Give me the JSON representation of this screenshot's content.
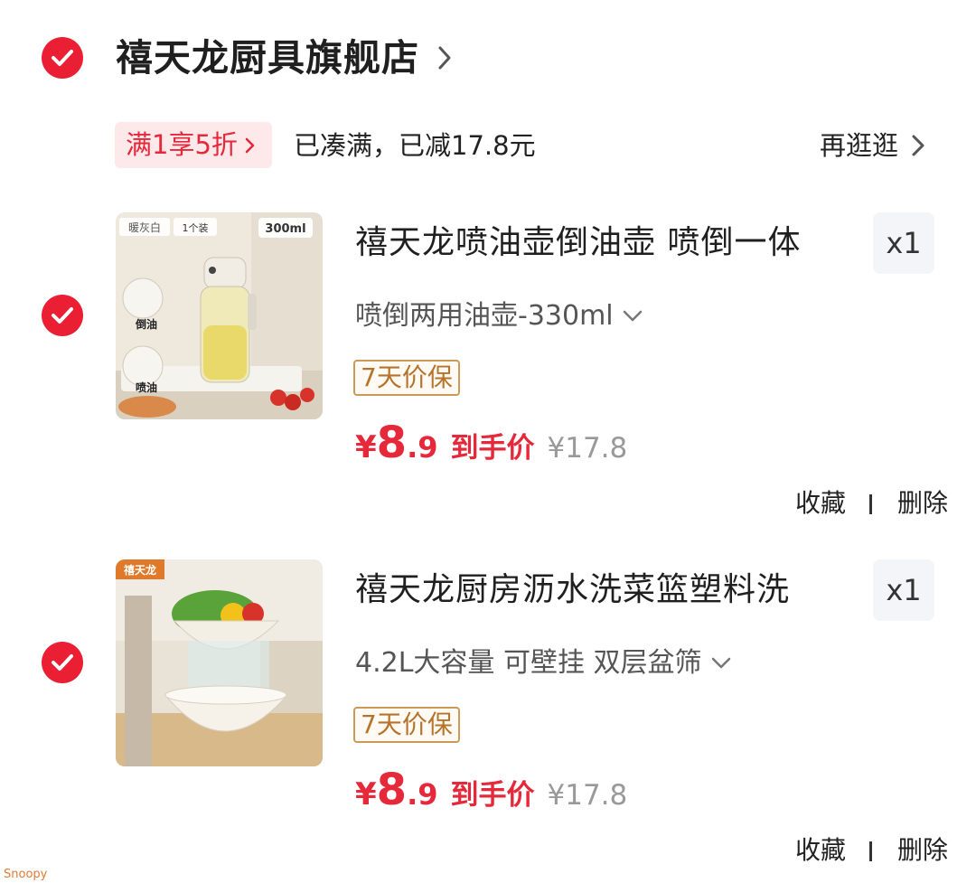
{
  "store": {
    "name": "禧天龙厨具旗舰店",
    "promo_tag": "满1享5折",
    "promo_text": "已凑满，已减17.8元",
    "more_label": "再逛逛"
  },
  "items": [
    {
      "title": "禧天龙喷油壶倒油壶 喷倒一体",
      "qty": "x1",
      "sku": "喷倒两用油壶-330ml",
      "badge": "7天价保",
      "price_currency": "¥",
      "price_int": "8",
      "price_dec": ".9",
      "price_label": "到手价",
      "price_original": "¥17.8",
      "thumb_tags": [
        "暖灰白",
        "1个装",
        "300ml"
      ],
      "thumb_labels": [
        "倒油",
        "喷油"
      ],
      "actions": [
        "收藏",
        "删除"
      ]
    },
    {
      "title": "禧天龙厨房沥水洗菜篮塑料洗",
      "qty": "x1",
      "sku": "4.2L大容量 可壁挂 双层盆筛",
      "badge": "7天价保",
      "price_currency": "¥",
      "price_int": "8",
      "price_dec": ".9",
      "price_label": "到手价",
      "price_original": "¥17.8",
      "thumb_tags": [
        "禧天龙"
      ],
      "actions": [
        "收藏",
        "删除"
      ]
    }
  ],
  "watermark": "Snoopy",
  "colors": {
    "accent": "#ea1f33",
    "badge_border": "#c99a5b",
    "qty_bg": "#f4f5f9"
  }
}
